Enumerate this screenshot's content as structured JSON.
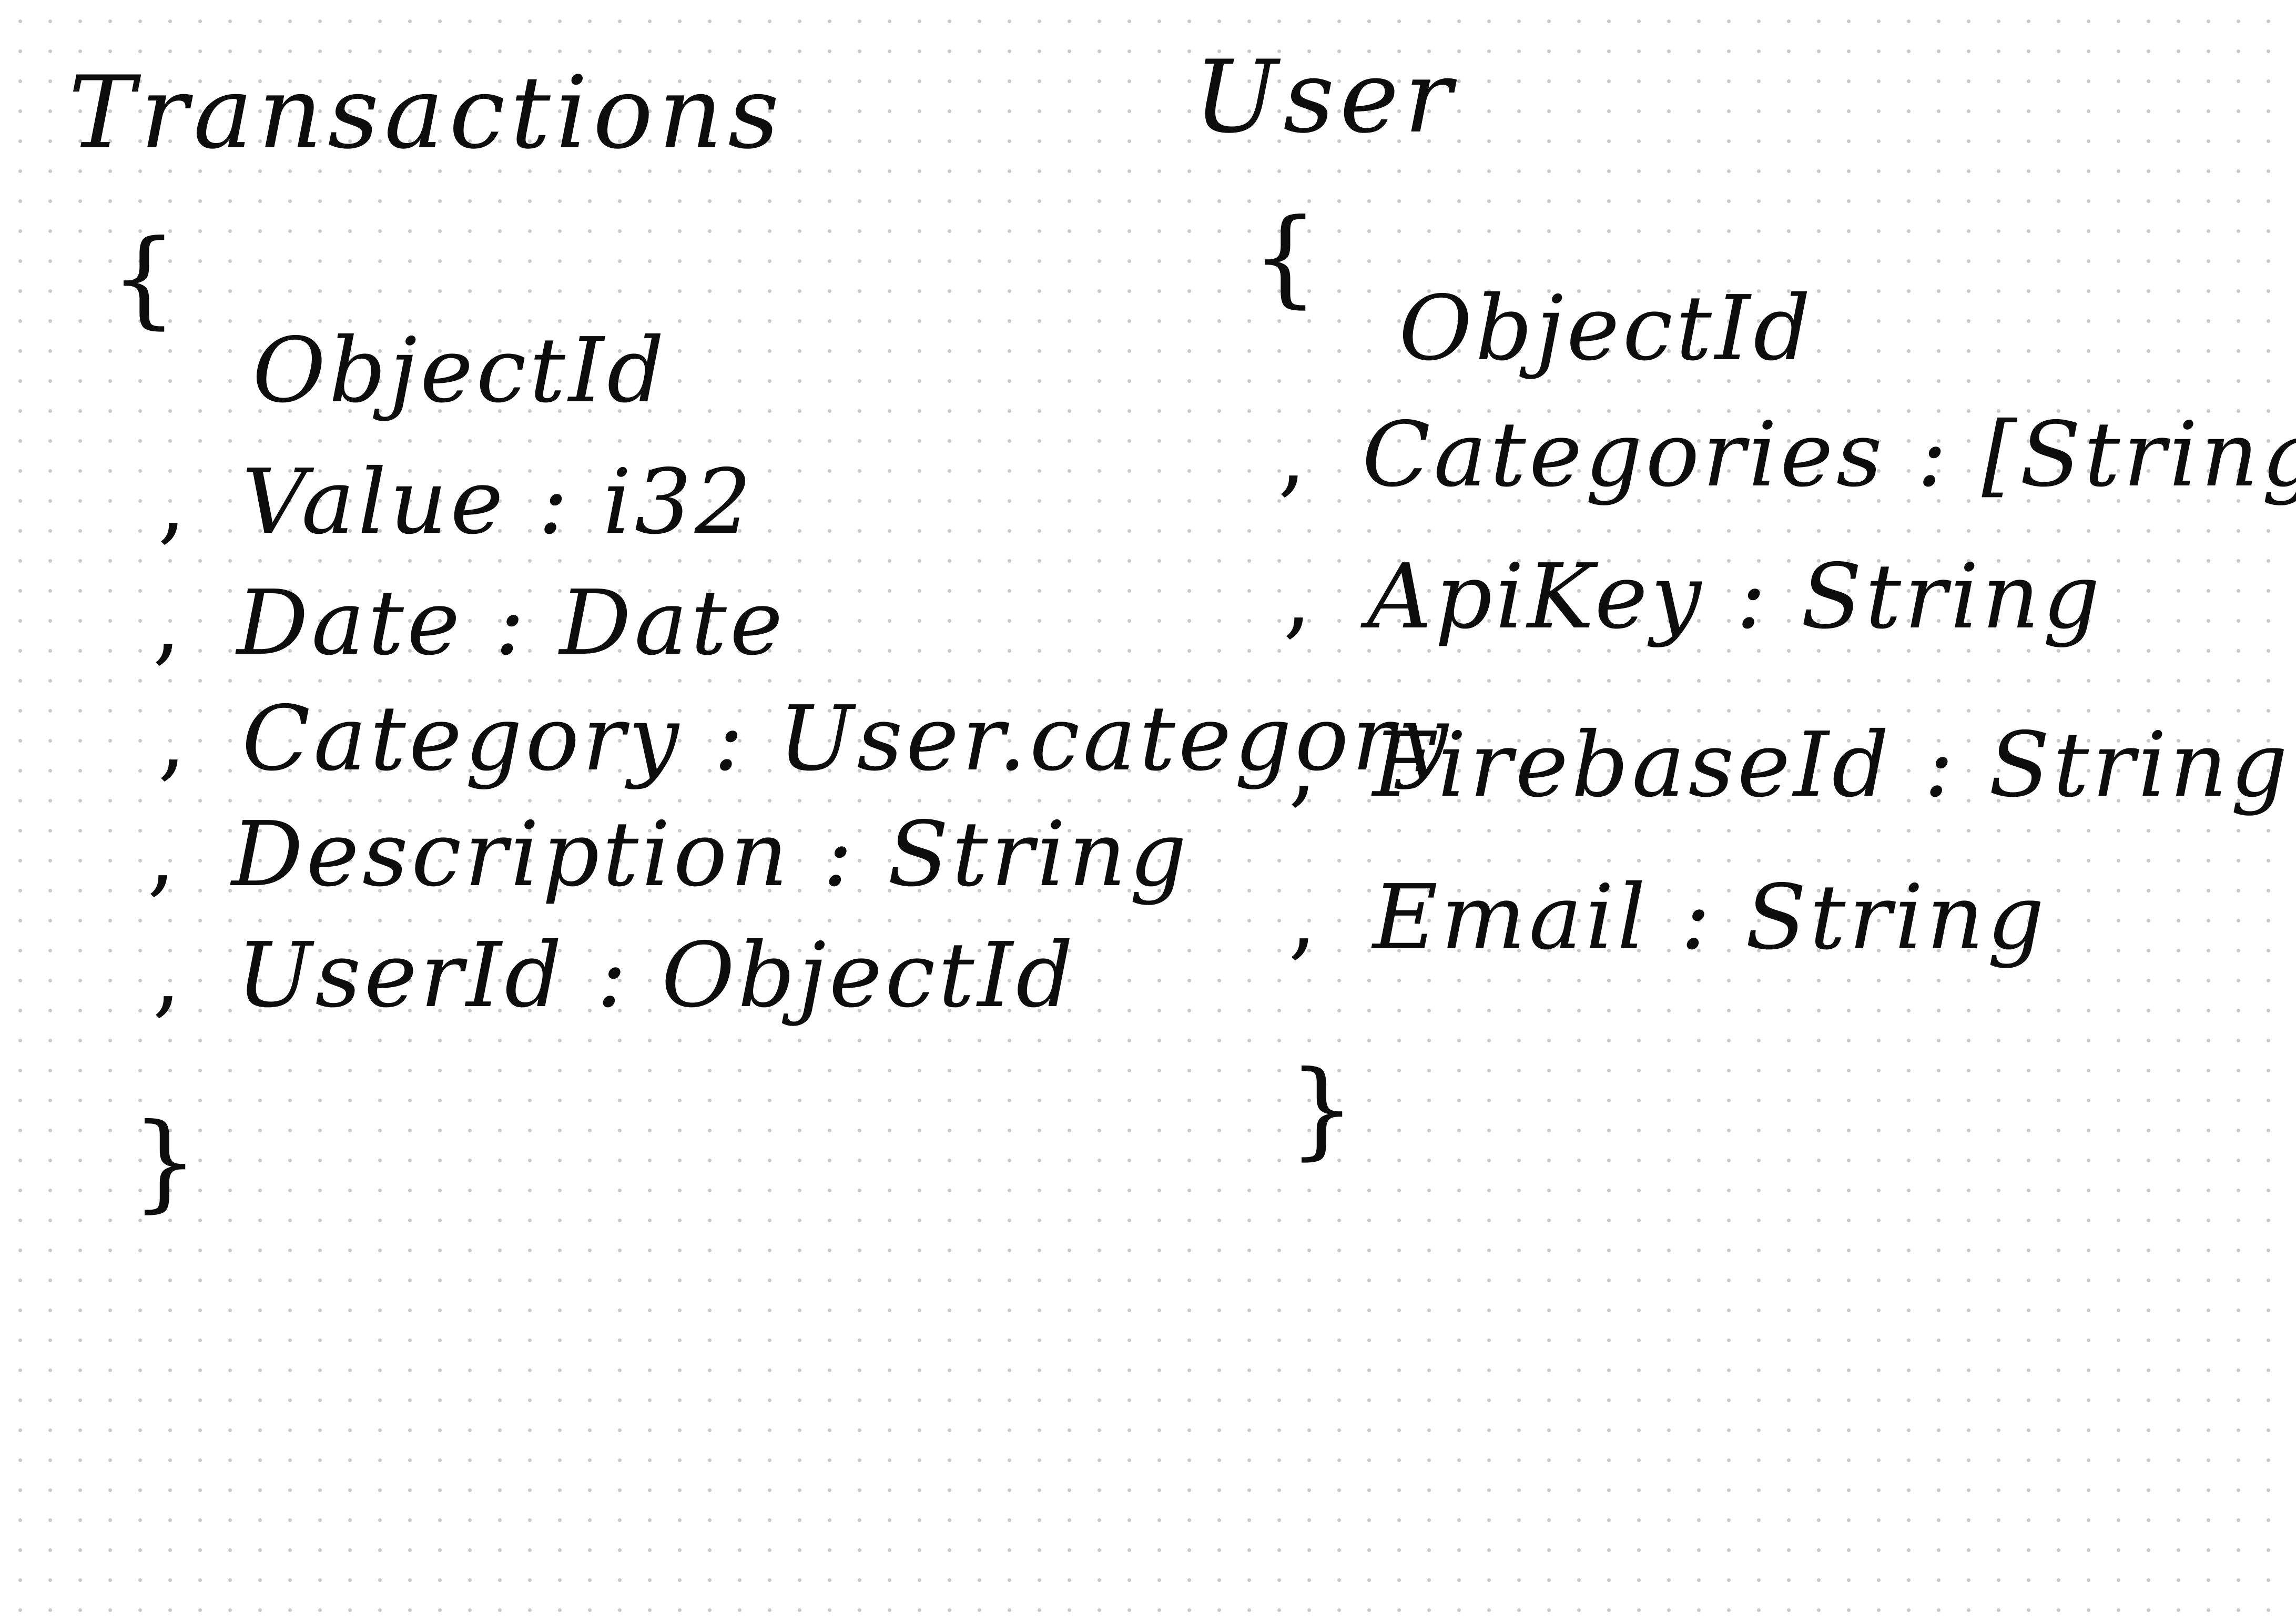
{
  "transactions": {
    "title": "Transactions",
    "open_brace": "{",
    "close_brace": "}",
    "fields": [
      {
        "sep": "",
        "text": "ObjectId"
      },
      {
        "sep": ",",
        "text": "Value : i32"
      },
      {
        "sep": ",",
        "text": "Date : Date"
      },
      {
        "sep": ",",
        "text": "Category : User.category"
      },
      {
        "sep": ",",
        "text": "Description : String"
      },
      {
        "sep": ",",
        "text": "UserId : ObjectId"
      }
    ]
  },
  "user": {
    "title": "User",
    "open_brace": "{",
    "close_brace": "}",
    "fields": [
      {
        "sep": "",
        "text": "ObjectId"
      },
      {
        "sep": ",",
        "text": "Categories : [String]"
      },
      {
        "sep": ",",
        "text": "ApiKey : String"
      },
      {
        "sep": ",",
        "text": "FirebaseId : String"
      },
      {
        "sep": ",",
        "text": "Email : String"
      }
    ]
  }
}
